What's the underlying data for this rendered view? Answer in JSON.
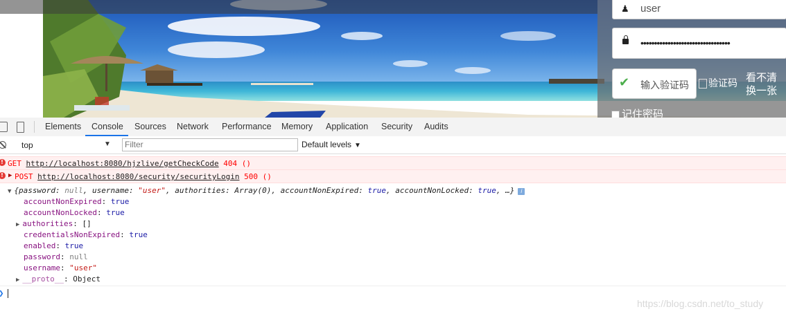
{
  "login": {
    "username_value": "user",
    "password_dots": "•••••••••••••••••••••••••••••••••",
    "captcha_placeholder": "输入验证码",
    "captcha_alt_text": "验证码",
    "refresh_label_line1": "看不清",
    "refresh_label_line2": "换一张",
    "remember_label": "记住密码"
  },
  "devtools": {
    "tabs": [
      "Elements",
      "Console",
      "Sources",
      "Network",
      "Performance",
      "Memory",
      "Application",
      "Security",
      "Audits"
    ],
    "active_tab": "Console",
    "context": "top",
    "filter_placeholder": "Filter",
    "levels_label": "Default levels",
    "console": {
      "errors": [
        {
          "method": "GET",
          "url": "http://localhost:8080/hjzlive/getCheckCode",
          "status": "404 ()"
        },
        {
          "method": "POST",
          "url": "http://localhost:8080/security/securityLogin",
          "status": "500 ()"
        }
      ],
      "object_summary": {
        "open": "{",
        "k1": "password",
        "v1": "null",
        "k2": "username",
        "v2": "\"user\"",
        "k3": "authorities",
        "v3": "Array(0)",
        "k4": "accountNonExpired",
        "v4": "true",
        "k5": "accountNonLocked",
        "v5": "true",
        "tail": "…}"
      },
      "properties": [
        {
          "key": "accountNonExpired",
          "value": "true",
          "type": "bool"
        },
        {
          "key": "accountNonLocked",
          "value": "true",
          "type": "bool"
        },
        {
          "key": "authorities",
          "value": "[]",
          "type": "plain",
          "expandable": true
        },
        {
          "key": "credentialsNonExpired",
          "value": "true",
          "type": "bool"
        },
        {
          "key": "enabled",
          "value": "true",
          "type": "bool"
        },
        {
          "key": "password",
          "value": "null",
          "type": "null"
        },
        {
          "key": "username",
          "value": "\"user\"",
          "type": "str"
        },
        {
          "key": "__proto__",
          "value": "Object",
          "type": "plain",
          "expandable": true
        }
      ]
    }
  },
  "watermark": "https://blog.csdn.net/to_study"
}
